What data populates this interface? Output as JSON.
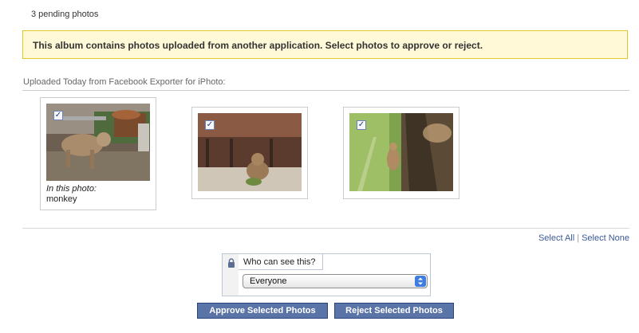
{
  "header": {
    "pending_count": "3 pending photos"
  },
  "notice": {
    "text": "This album contains photos uploaded from another application. Select photos to approve or reject."
  },
  "section": {
    "label": "Uploaded Today from Facebook Exporter for iPhoto:"
  },
  "photos": [
    {
      "checked": true,
      "tag_label": "In this photo:",
      "tag_value": "monkey"
    },
    {
      "checked": true
    },
    {
      "checked": true
    }
  ],
  "selection_links": {
    "select_all": "Select All",
    "separator": "|",
    "select_none": "Select None"
  },
  "privacy": {
    "label": "Who can see this?",
    "selected": "Everyone"
  },
  "buttons": {
    "approve": "Approve Selected Photos",
    "reject": "Reject Selected Photos"
  },
  "icons": {
    "checkbox": "checkmark",
    "lock": "lock-icon",
    "select": "select-arrows-icon"
  },
  "colors": {
    "brand": "#3b5998",
    "button": "#5b74a8",
    "notice_bg": "#fff9d7",
    "notice_border": "#e2c822"
  }
}
